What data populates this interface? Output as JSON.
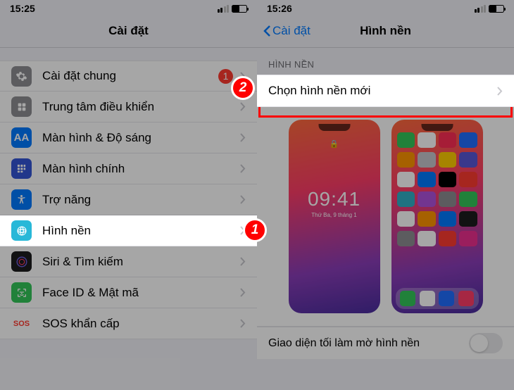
{
  "left": {
    "status_time": "15:25",
    "title": "Cài đặt",
    "items": [
      {
        "label": "Cài đặt chung",
        "badge": "1"
      },
      {
        "label": "Trung tâm điều khiển"
      },
      {
        "label": "Màn hình & Độ sáng"
      },
      {
        "label": "Màn hình chính"
      },
      {
        "label": "Trợ năng"
      },
      {
        "label": "Hình nền"
      },
      {
        "label": "Siri & Tìm kiếm"
      },
      {
        "label": "Face ID & Mật mã"
      },
      {
        "label": "SOS khẩn cấp"
      }
    ]
  },
  "right": {
    "status_time": "15:26",
    "back_label": "Cài đặt",
    "title": "Hình nền",
    "section_header": "HÌNH NỀN",
    "choose_label": "Chọn hình nền mới",
    "lock_time": "09:41",
    "lock_date": "Thứ Ba, 9 tháng 1",
    "dark_toggle_label": "Giao diện tối làm mờ hình nền"
  },
  "markers": {
    "one": "1",
    "two": "2"
  },
  "colors": {
    "highlight": "#ff0000",
    "accent": "#007aff"
  }
}
